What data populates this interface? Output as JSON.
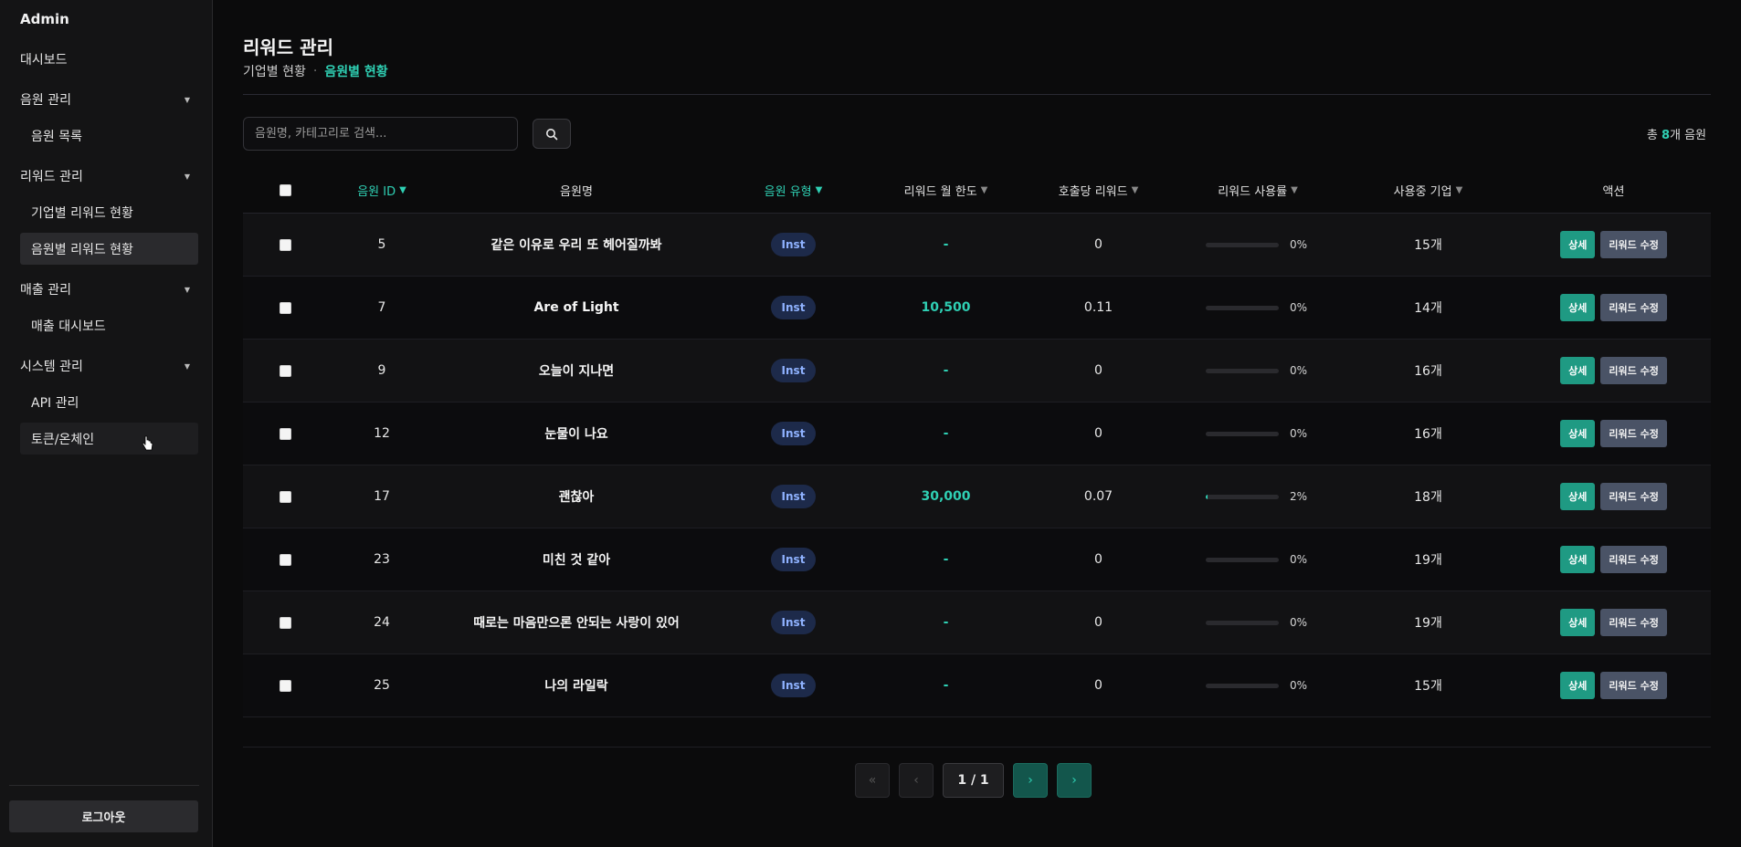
{
  "sidebar": {
    "brand": "Admin",
    "dashboard": "대시보드",
    "groups": [
      {
        "label": "음원 관리",
        "items": [
          "음원 목록"
        ]
      },
      {
        "label": "리워드 관리",
        "items": [
          "기업별 리워드 현황",
          "음원별 리워드 현황"
        ]
      },
      {
        "label": "매출 관리",
        "items": [
          "매출 대시보드"
        ]
      },
      {
        "label": "시스템 관리",
        "items": [
          "API 관리",
          "토큰/온체인"
        ]
      }
    ],
    "active_item": "음원별 리워드 현황",
    "logout": "로그아웃"
  },
  "header": {
    "title": "리워드 관리",
    "breadcrumb": [
      "기업별 현황",
      "·",
      "음원별 현황"
    ]
  },
  "toolbar": {
    "search_placeholder": "음원명, 카테고리로 검색...",
    "total_prefix": "총 ",
    "total_count": "8",
    "total_suffix": "개 음원"
  },
  "table": {
    "headers": {
      "id": "음원 ID",
      "name": "음원명",
      "type": "음원 유형",
      "monthly_limit": "리워드 월 한도",
      "per_call": "호출당 리워드",
      "usage": "리워드 사용률",
      "companies": "사용중 기업",
      "actions": "액션"
    },
    "sort_symbol": "▼",
    "detail_label": "상세",
    "edit_label": "리워드 수정",
    "rows": [
      {
        "id": "5",
        "name": "같은 이유로 우리 또 헤어질까봐",
        "type": "Inst",
        "limit": "-",
        "per_call": "0",
        "usage": 0,
        "usage_text": "0%",
        "companies": "15개"
      },
      {
        "id": "7",
        "name": "Are of Light",
        "type": "Inst",
        "limit": "10,500",
        "per_call": "0.11",
        "usage": 0,
        "usage_text": "0%",
        "companies": "14개"
      },
      {
        "id": "9",
        "name": "오늘이 지나면",
        "type": "Inst",
        "limit": "-",
        "per_call": "0",
        "usage": 0,
        "usage_text": "0%",
        "companies": "16개"
      },
      {
        "id": "12",
        "name": "눈물이 나요",
        "type": "Inst",
        "limit": "-",
        "per_call": "0",
        "usage": 0,
        "usage_text": "0%",
        "companies": "16개"
      },
      {
        "id": "17",
        "name": "괜찮아",
        "type": "Inst",
        "limit": "30,000",
        "per_call": "0.07",
        "usage": 2,
        "usage_text": "2%",
        "companies": "18개"
      },
      {
        "id": "23",
        "name": "미친 것 같아",
        "type": "Inst",
        "limit": "-",
        "per_call": "0",
        "usage": 0,
        "usage_text": "0%",
        "companies": "19개"
      },
      {
        "id": "24",
        "name": "때로는 마음만으론 안되는 사랑이 있어",
        "type": "Inst",
        "limit": "-",
        "per_call": "0",
        "usage": 0,
        "usage_text": "0%",
        "companies": "19개"
      },
      {
        "id": "25",
        "name": "나의 라일락",
        "type": "Inst",
        "limit": "-",
        "per_call": "0",
        "usage": 0,
        "usage_text": "0%",
        "companies": "15개"
      }
    ]
  },
  "pagination": {
    "first": "«",
    "prev": "‹",
    "page": "1 / 1",
    "next": "›",
    "last": "›"
  },
  "colors": {
    "accent": "#2fd0b4",
    "badge_bg": "#1d2a4a",
    "edit_btn": "#4a5366"
  }
}
